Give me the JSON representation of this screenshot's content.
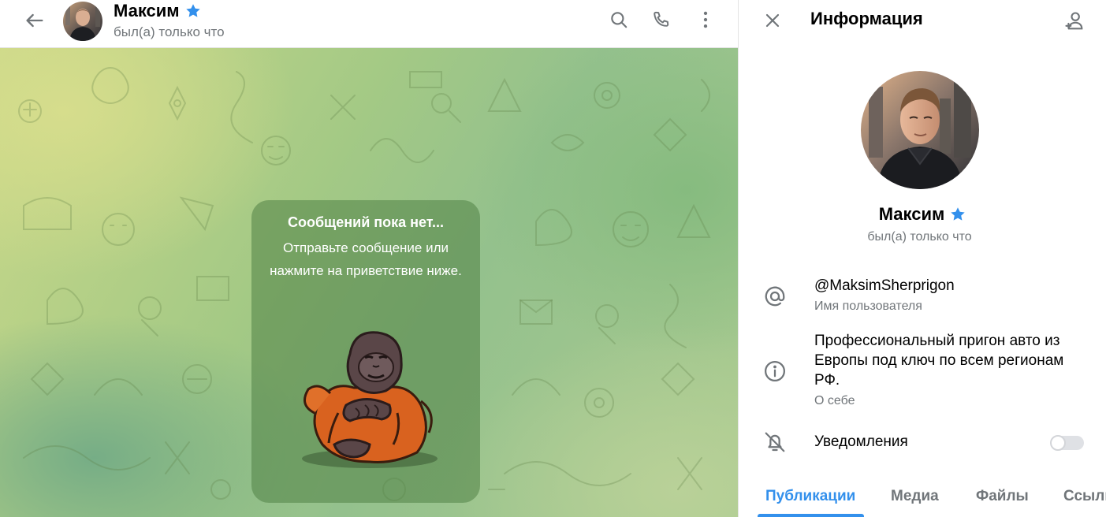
{
  "chat": {
    "header": {
      "name": "Максим",
      "status": "был(а) только что"
    },
    "empty_state": {
      "title": "Сообщений пока нет...",
      "text": "Отправьте сообщение или нажмите на приветствие ниже."
    },
    "icons": {
      "back": "arrow-left-icon",
      "verified": "star-badge-icon",
      "search": "search-icon",
      "call": "phone-icon",
      "more": "more-vertical-icon",
      "sticker": "orangutan-sticker"
    }
  },
  "info": {
    "title": "Информация",
    "name": "Максим",
    "status": "был(а) только что",
    "username": {
      "value": "@MaksimSherprigon",
      "label": "Имя пользователя"
    },
    "bio": {
      "value": "Профессиональный пригон авто из Европы под ключ по всем регионам РФ.",
      "label": "О себе"
    },
    "notifications": {
      "label": "Уведомления",
      "enabled": false
    },
    "tabs": [
      {
        "label": "Публикации",
        "active": true
      },
      {
        "label": "Медиа",
        "active": false
      },
      {
        "label": "Файлы",
        "active": false
      },
      {
        "label": "Ссылки",
        "active": false
      }
    ]
  },
  "colors": {
    "accent": "#3390ec",
    "muted_text": "#707579",
    "icon_gray": "#707579"
  }
}
